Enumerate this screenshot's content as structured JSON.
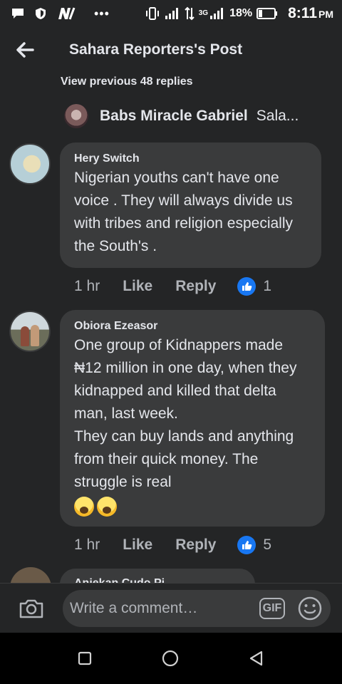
{
  "status_bar": {
    "battery": "18%",
    "time": "8:11",
    "ampm": "PM",
    "network": "3G"
  },
  "header": {
    "title": "Sahara Reporters's Post"
  },
  "thread": {
    "view_previous": "View previous 48 replies",
    "parent_name": "Babs Miracle Gabriel",
    "parent_snippet": "Sala..."
  },
  "comments": [
    {
      "author": "Hery Switch",
      "text": "Nigerian youths can't have one voice . They will always divide us with tribes and religion especially the South's .",
      "time": "1 hr",
      "like": "Like",
      "reply": "Reply",
      "reaction_count": "1"
    },
    {
      "author": "Obiora Ezeasor",
      "text": "One group of Kidnappers made ₦12 million in one day, when they kidnapped and killed that delta man, last week.\nThey can buy lands and anything from their quick money. The struggle is real",
      "time": "1 hr",
      "like": "Like",
      "reply": "Reply",
      "reaction_count": "5"
    }
  ],
  "peek_comment": {
    "author": "Aniekan Cudo Pi..."
  },
  "composer": {
    "placeholder": "Write a comment…",
    "gif_label": "GIF"
  },
  "icons": {
    "back": "arrow-left-icon",
    "camera": "camera-icon",
    "emoji": "smiley-icon",
    "like_reaction": "thumbs-up-icon",
    "nav": [
      "square-icon",
      "circle-icon",
      "triangle-back-icon"
    ]
  },
  "colors": {
    "background": "#18191a",
    "surface": "#242526",
    "bubble": "#3a3b3c",
    "text": "#e4e6eb",
    "secondary_text": "#b0b3b8",
    "accent": "#1877f2"
  }
}
